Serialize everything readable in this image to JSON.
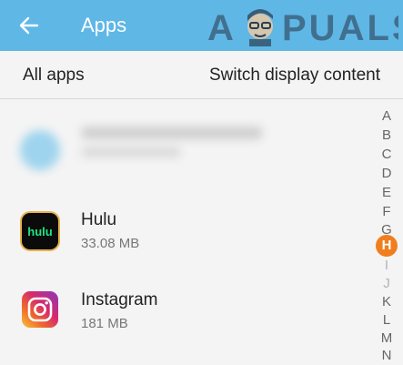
{
  "appbar": {
    "title": "Apps",
    "back_icon": "arrow-left-icon",
    "background": "#5fb7e6",
    "watermark": "APPUALS"
  },
  "subheader": {
    "all_apps": "All apps",
    "switch_display": "Switch display content"
  },
  "apps": [
    {
      "name": "",
      "size": "",
      "icon": "blurred-app-icon",
      "blurred": true
    },
    {
      "name": "Hulu",
      "size": "33.08 MB",
      "icon": "hulu-icon",
      "icon_text": "hulu"
    },
    {
      "name": "Instagram",
      "size": "181 MB",
      "icon": "instagram-icon"
    }
  ],
  "index": {
    "letters": [
      "A",
      "B",
      "C",
      "D",
      "E",
      "F",
      "G",
      "H",
      "I",
      "J",
      "K",
      "L",
      "M",
      "N"
    ],
    "active": "H",
    "accent": "#f07e1e"
  }
}
